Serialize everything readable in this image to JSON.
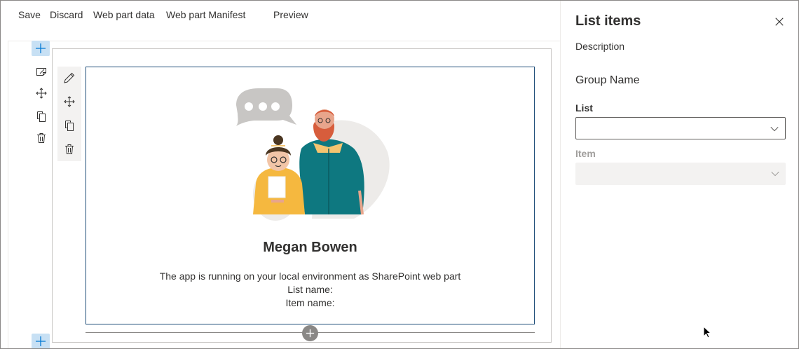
{
  "toolbar": {
    "save_label": "Save",
    "discard_label": "Discard",
    "web_part_data_label": "Web part data",
    "web_part_manifest_label": "Web part Manifest",
    "preview_label": "Preview"
  },
  "icons": {
    "add_section": "plus-icon",
    "edit_section": "edit-section-icon",
    "move": "move-icon",
    "duplicate": "copy-icon",
    "delete": "trash-icon",
    "edit_webpart": "pencil-icon",
    "close": "close-icon",
    "dropdown": "chevron-down-icon"
  },
  "webpart": {
    "title": "Megan Bowen",
    "line1": "The app is running on your local environment as SharePoint web part",
    "line2": "List name:",
    "line3": "Item name:"
  },
  "pane": {
    "title": "List items",
    "description": "Description",
    "group_name": "Group Name",
    "list_label": "List",
    "list_value": "",
    "item_label": "Item",
    "item_value": ""
  },
  "colors": {
    "accent_light": "#c7e0f4",
    "accent": "#0078d4",
    "webpart_border": "#1f4e79",
    "text": "#323130",
    "disabled_text": "#a19f9d"
  }
}
